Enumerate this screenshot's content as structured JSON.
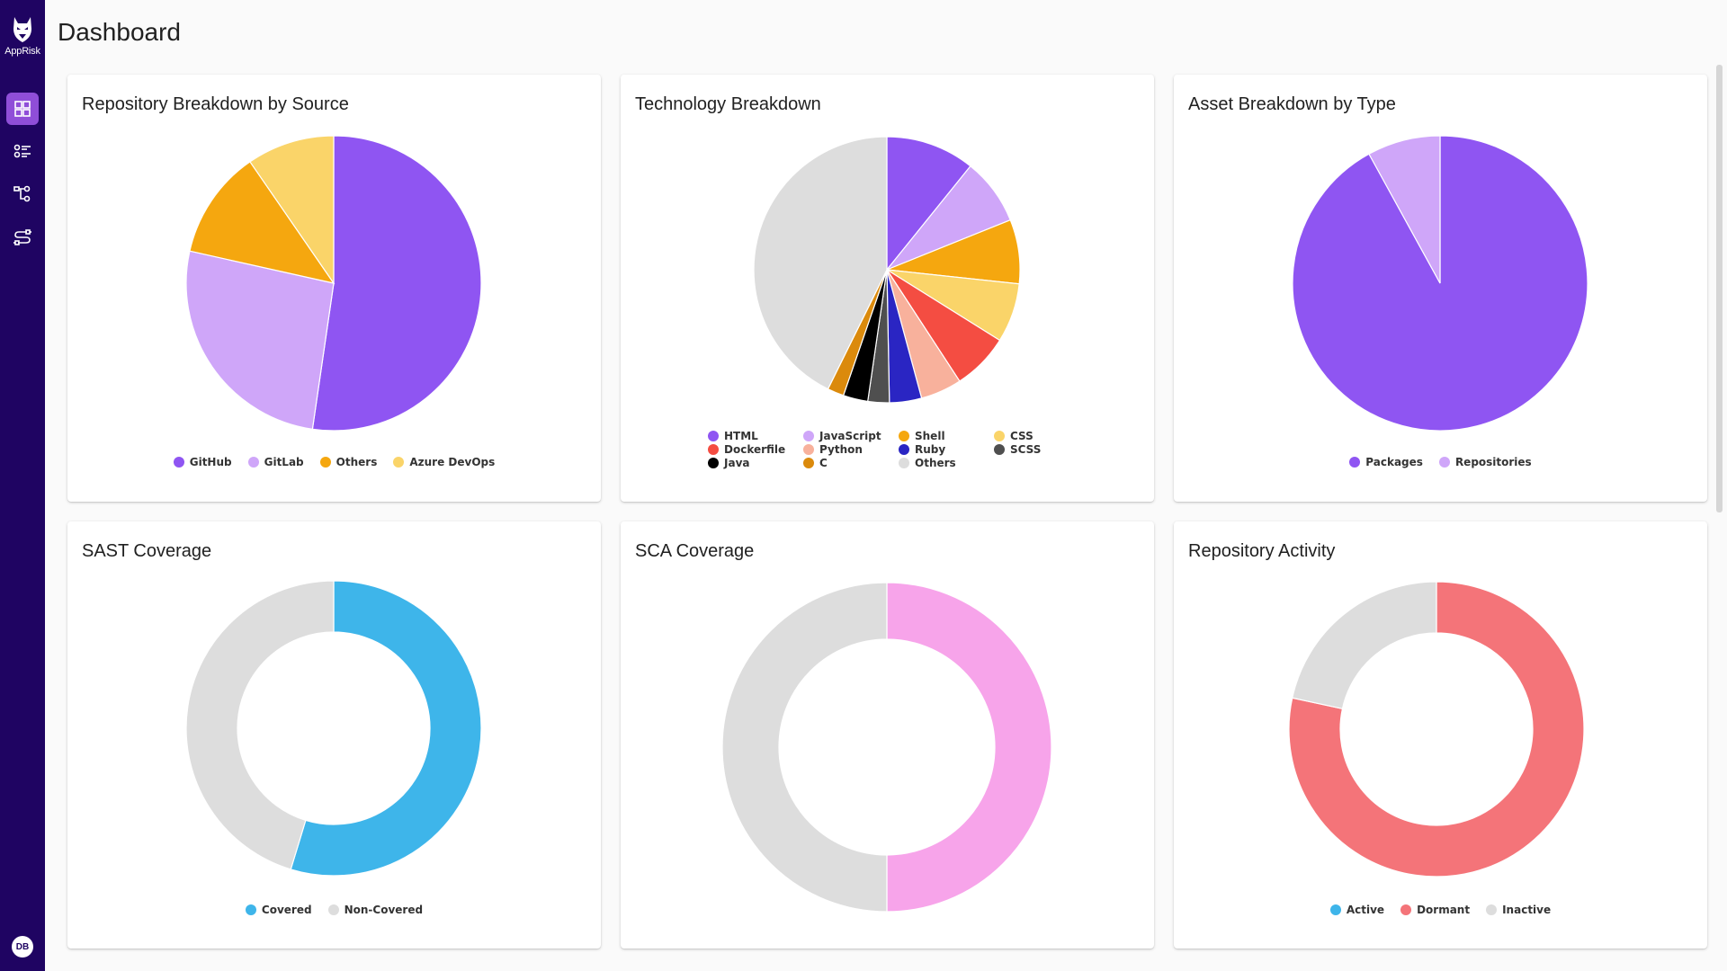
{
  "app": {
    "name": "AppRisk",
    "user_initials": "DB"
  },
  "sidebar": {
    "items": [
      {
        "name": "dashboard",
        "icon": "dashboard-grid-icon",
        "active": true
      },
      {
        "name": "list",
        "icon": "list-icon",
        "active": false
      },
      {
        "name": "hierarchy",
        "icon": "hierarchy-icon",
        "active": false
      },
      {
        "name": "integrations",
        "icon": "integrations-icon",
        "active": false
      }
    ]
  },
  "header": {
    "title": "Dashboard"
  },
  "chart_data": [
    {
      "id": "repo-source",
      "type": "pie",
      "title": "Repository Breakdown by Source",
      "categories": [
        "GitHub",
        "GitLab",
        "Others",
        "Azure DevOps"
      ],
      "values": [
        52.3,
        26.2,
        11.9,
        9.6
      ],
      "colors": [
        "#8f55f2",
        "#cfa6f9",
        "#f5a70f",
        "#fad469"
      ],
      "legend": "bottom"
    },
    {
      "id": "technology",
      "type": "pie",
      "title": "Technology Breakdown",
      "categories": [
        "HTML",
        "JavaScript",
        "Shell",
        "CSS",
        "Dockerfile",
        "Python",
        "Ruby",
        "SCSS",
        "Java",
        "C",
        "Others"
      ],
      "values": [
        10.8,
        8.1,
        7.8,
        7.2,
        6.9,
        5.0,
        3.9,
        2.6,
        3.0,
        2.0,
        42.7
      ],
      "colors": [
        "#8f55f2",
        "#cfa6f9",
        "#f5a70f",
        "#fad469",
        "#f44d42",
        "#f8b19c",
        "#2a25c3",
        "#4f4f4f",
        "#000000",
        "#db8a0c",
        "#dddddd"
      ],
      "legend_order": [
        "HTML",
        "JavaScript",
        "Shell",
        "CSS",
        "Dockerfile",
        "Python",
        "Ruby",
        "SCSS",
        "Java",
        "C",
        "Others"
      ],
      "legend": "bottom"
    },
    {
      "id": "asset-type",
      "type": "pie",
      "title": "Asset Breakdown by Type",
      "categories": [
        "Packages",
        "Repositories"
      ],
      "values": [
        92,
        8
      ],
      "colors": [
        "#8f55f2",
        "#cfa6f9"
      ],
      "legend": "bottom"
    },
    {
      "id": "sast",
      "type": "pie",
      "donut": true,
      "title": "SAST Coverage",
      "categories": [
        "Covered",
        "Non-Covered"
      ],
      "values": [
        54.7,
        45.3
      ],
      "colors": [
        "#3eb5ea",
        "#dddddd"
      ],
      "legend": "bottom"
    },
    {
      "id": "sca",
      "type": "pie",
      "donut": true,
      "title": "SCA Coverage",
      "categories": [
        "Covered",
        "Non-Covered"
      ],
      "values": [
        50,
        50
      ],
      "colors": [
        "#f7a4ea",
        "#dddddd"
      ],
      "legend": "none"
    },
    {
      "id": "repo-activity",
      "type": "pie",
      "donut": true,
      "title": "Repository Activity",
      "categories": [
        "Active",
        "Dormant",
        "Inactive"
      ],
      "values": [
        0,
        78.4,
        21.6
      ],
      "colors": [
        "#3eb5ea",
        "#f47479",
        "#dddddd"
      ],
      "legend": "bottom"
    }
  ]
}
